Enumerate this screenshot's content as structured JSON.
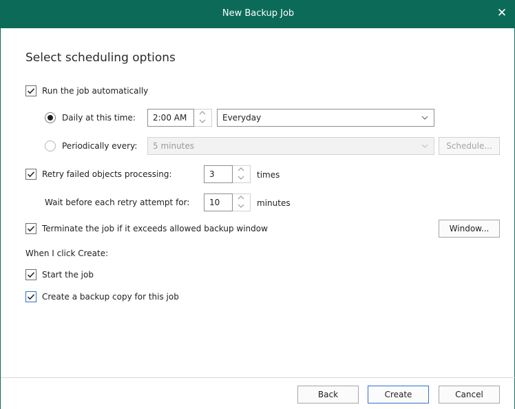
{
  "window": {
    "title": "New Backup Job",
    "close_glyph": "✕"
  },
  "heading": "Select scheduling options",
  "run_auto": {
    "label": "Run the job automatically",
    "checked": true
  },
  "daily": {
    "label": "Daily at this time:",
    "selected": true,
    "time_value": "2:00 AM",
    "frequency_value": "Everyday"
  },
  "periodic": {
    "label": "Periodically every:",
    "selected": false,
    "interval_value": "5 minutes",
    "schedule_button": "Schedule..."
  },
  "retry": {
    "label": "Retry failed objects processing:",
    "checked": true,
    "count_value": "3",
    "count_unit": "times",
    "wait_label": "Wait before each retry attempt for:",
    "wait_value": "10",
    "wait_unit": "minutes"
  },
  "terminate": {
    "label": "Terminate the job if it exceeds allowed backup window",
    "checked": true,
    "window_button": "Window..."
  },
  "on_create": {
    "label": "When I click Create:",
    "start_job": {
      "label": "Start the job",
      "checked": true
    },
    "backup_copy": {
      "label": "Create a backup copy for this job",
      "checked": true
    }
  },
  "footer": {
    "back": "Back",
    "create": "Create",
    "cancel": "Cancel"
  },
  "icons": {
    "checkmark": "check-icon",
    "spin_up": "chevron-up-icon",
    "spin_down": "chevron-down-icon",
    "dropdown": "chevron-down-icon"
  },
  "colors": {
    "titlebar": "#0c6b58",
    "focus_accent": "#2e6fd0"
  }
}
